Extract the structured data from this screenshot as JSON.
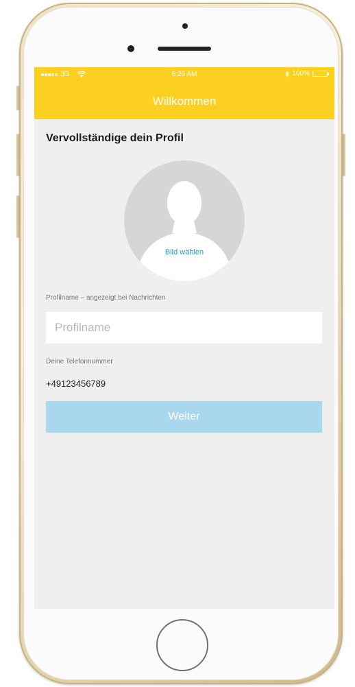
{
  "status_bar": {
    "carrier": "3G",
    "time": "6:29 AM",
    "battery": "100%"
  },
  "header": {
    "title": "Willkommen",
    "color": "#fbd020"
  },
  "profile": {
    "section_title": "Vervollständige dein Profil",
    "choose_photo_label": "Bild wählen",
    "name_label": "Profilname – angezeigt bei Nachrichten",
    "name_placeholder": "Profilname",
    "name_value": "",
    "phone_label": "Deine Telefonnummer",
    "phone_value": "+49123456789"
  },
  "actions": {
    "continue_label": "Weiter",
    "continue_color": "#a9d7ee"
  },
  "icons": {
    "signal": "signal-icon",
    "wifi": "wifi-icon",
    "bluetooth": "bluetooth-icon",
    "battery": "battery-icon",
    "avatar": "person-silhouette-icon"
  }
}
